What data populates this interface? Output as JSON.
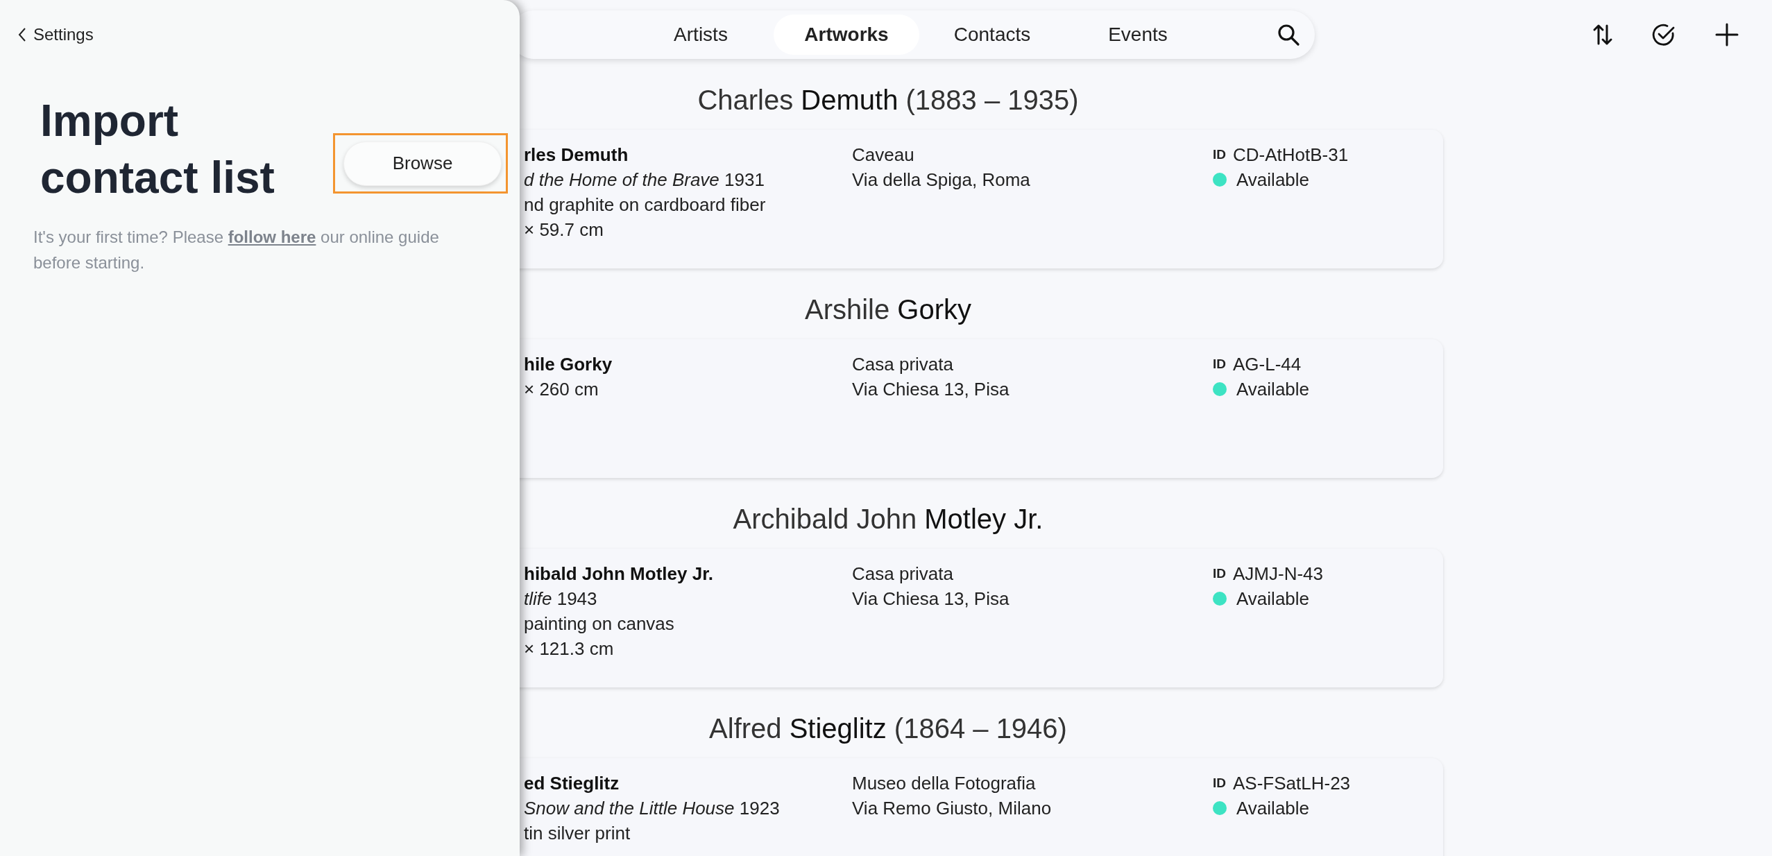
{
  "panel": {
    "back_label": "Settings",
    "title": "Import contact list",
    "browse_button": {
      "label": "Browse",
      "focused": true
    },
    "guide": {
      "before": "It's your first time? Please ",
      "link": "follow here",
      "after": " our online guide before starting."
    }
  },
  "tabs": [
    {
      "label": "Artists",
      "selected": false
    },
    {
      "label": "Artworks",
      "selected": true
    },
    {
      "label": "Contacts",
      "selected": false
    },
    {
      "label": "Events",
      "selected": false
    }
  ],
  "artworks": [
    {
      "heading": "Charles **Demuth** (1883 – 1935)",
      "lines": [
        {
          "kind": "name",
          "text": "rles Demuth"
        },
        {
          "kind": "title",
          "text": "*d the Home of the Brave* 1931"
        },
        {
          "kind": "text",
          "text": "nd graphite on cardboard fiber"
        },
        {
          "kind": "text",
          "text": "× 59.7 cm"
        }
      ],
      "location": "Caveau",
      "address": "Via della Spiga, Roma",
      "id_label": "ID",
      "id": "CD-AtHotB-31",
      "status": {
        "label": "Available",
        "color": "#3de3c3"
      }
    },
    {
      "heading": "Arshile **Gorky**",
      "lines": [
        {
          "kind": "name",
          "text": "hile Gorky"
        },
        {
          "kind": "text",
          "text": "× 260 cm"
        }
      ],
      "location": "Casa privata",
      "address": "Via Chiesa 13, Pisa",
      "id_label": "ID",
      "id": "AG-L-44",
      "status": {
        "label": "Available",
        "color": "#3de3c3"
      }
    },
    {
      "heading": "Archibald John **Motley Jr.**",
      "lines": [
        {
          "kind": "name",
          "text": "hibald John Motley Jr."
        },
        {
          "kind": "title",
          "text": "*tlife* 1943"
        },
        {
          "kind": "text",
          "text": "painting on canvas"
        },
        {
          "kind": "text",
          "text": "× 121.3 cm"
        }
      ],
      "location": "Casa privata",
      "address": "Via Chiesa 13, Pisa",
      "id_label": "ID",
      "id": "AJMJ-N-43",
      "status": {
        "label": "Available",
        "color": "#3de3c3"
      }
    },
    {
      "heading": "Alfred **Stieglitz** (1864 – 1946)",
      "lines": [
        {
          "kind": "name",
          "text": "ed Stieglitz"
        },
        {
          "kind": "title",
          "text": "*Snow and the Little House* 1923"
        },
        {
          "kind": "text",
          "text": "tin silver print"
        }
      ],
      "location": "Museo della Fotografia",
      "address": "Via Remo Giusto, Milano",
      "id_label": "ID",
      "id": "AS-FSatLH-23",
      "status": {
        "label": "Available",
        "color": "#3de3c3"
      }
    }
  ]
}
